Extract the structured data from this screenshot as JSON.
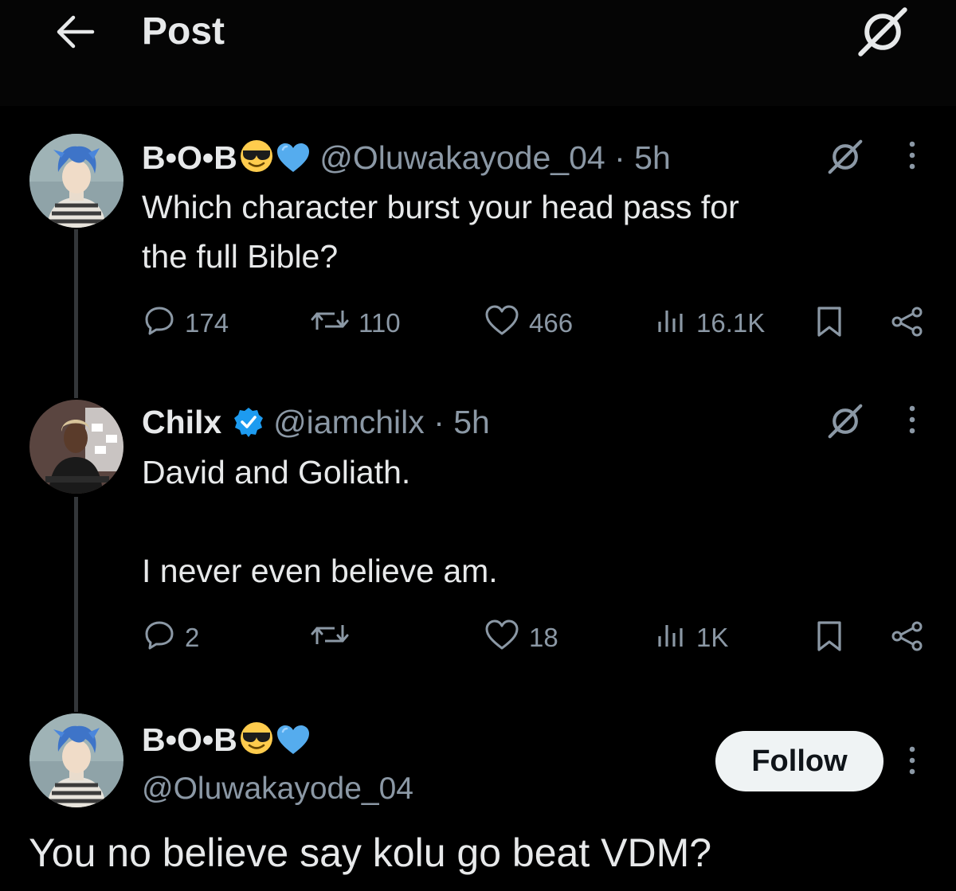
{
  "header": {
    "title": "Post",
    "back_icon": "arrow-left-icon",
    "grok_icon": "grok-icon"
  },
  "colors": {
    "background": "#000000",
    "text_primary": "#e7e9ea",
    "text_secondary": "#8b98a5",
    "verified": "#1d9bf0",
    "follow_bg": "#eff3f4"
  },
  "tweets": [
    {
      "name": "B•O•B",
      "emojis": [
        "sunglasses-face-emoji",
        "blue-heart-emoji"
      ],
      "handle": "@Oluwakayode_04",
      "time": "· 5h",
      "text": "Which character burst your head pass for\nthe full Bible?",
      "replies": "174",
      "reposts": "110",
      "likes": "466",
      "views": "16.1K"
    },
    {
      "name": "Chilx",
      "verified": true,
      "handle": "@iamchilx",
      "time": "· 5h",
      "text": "David and Goliath.\n\nI never even believe am.",
      "replies": "2",
      "reposts": "",
      "likes": "18",
      "views": "1K"
    }
  ],
  "main_post": {
    "name": "B•O•B",
    "emojis": [
      "sunglasses-face-emoji",
      "blue-heart-emoji"
    ],
    "handle": "@Oluwakayode_04",
    "follow_label": "Follow",
    "text": "You no believe say kolu go beat VDM?"
  }
}
